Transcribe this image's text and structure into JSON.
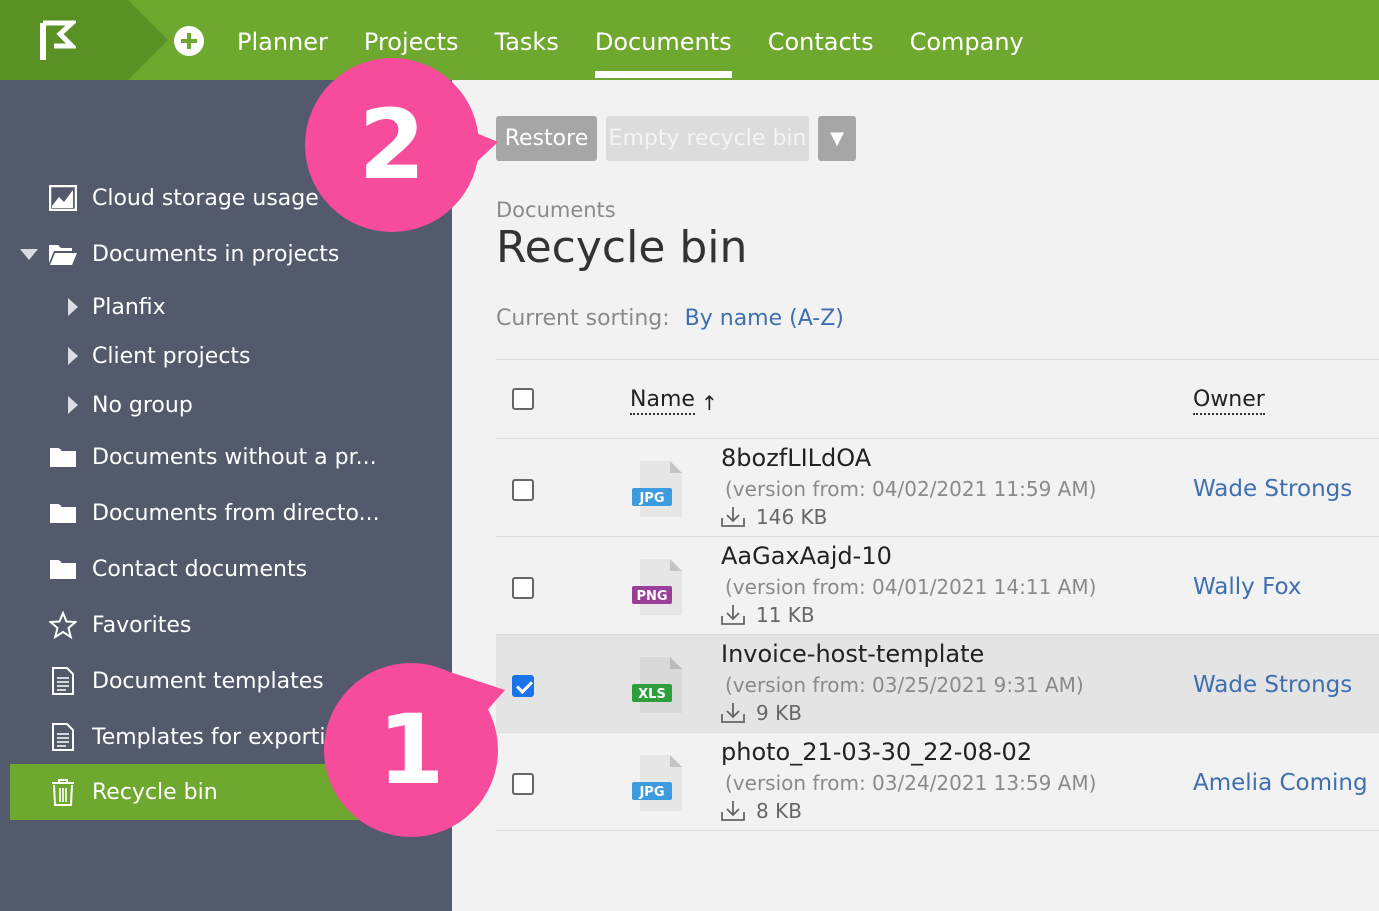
{
  "topbar": {
    "nav": [
      "Planner",
      "Projects",
      "Tasks",
      "Documents",
      "Contacts",
      "Company"
    ],
    "active": "Documents"
  },
  "sidebar": {
    "items": [
      {
        "label": "Cloud storage usage",
        "icon": "chart-icon"
      },
      {
        "label": "Documents in projects",
        "icon": "folder-open-icon"
      },
      {
        "label": "Planfix",
        "icon": "caret-right-icon"
      },
      {
        "label": "Client projects",
        "icon": "caret-right-icon"
      },
      {
        "label": "No group",
        "icon": "caret-right-icon"
      },
      {
        "label": "Documents without a pr...",
        "icon": "folder-icon"
      },
      {
        "label": "Documents from directo...",
        "icon": "folder-icon"
      },
      {
        "label": "Contact documents",
        "icon": "folder-icon"
      },
      {
        "label": "Favorites",
        "icon": "star-icon"
      },
      {
        "label": "Document templates",
        "icon": "document-icon"
      },
      {
        "label": "Templates for exporting",
        "icon": "document-icon"
      },
      {
        "label": "Recycle bin",
        "icon": "trash-icon"
      }
    ]
  },
  "toolbar": {
    "restore_label": "Restore",
    "empty_label": "Empty recycle bin",
    "more_label": "▼"
  },
  "main": {
    "breadcrumb": "Documents",
    "title": "Recycle bin",
    "sorting_label": "Current sorting:",
    "sorting_value": "By name (A-Z)"
  },
  "table": {
    "headers": {
      "name": "Name",
      "owner": "Owner",
      "sort_arrow": "↑"
    },
    "rows": [
      {
        "name": "8bozfLILdOA",
        "version": "(version from: 04/02/2021 11:59 AM)",
        "size": "146 KB",
        "owner": "Wade Strongs",
        "type": "JPG",
        "type_color": "#3d9be0",
        "checked": false
      },
      {
        "name": "AaGaxAajd-10",
        "version": "(version from: 04/01/2021 14:11 AM)",
        "size": "11 KB",
        "owner": "Wally Fox",
        "type": "PNG",
        "type_color": "#9a3f98",
        "checked": false
      },
      {
        "name": "Invoice-host-template",
        "version": "(version from: 03/25/2021 9:31 AM)",
        "size": "9 KB",
        "owner": "Wade Strongs",
        "type": "XLS",
        "type_color": "#2e9e3a",
        "checked": true
      },
      {
        "name": "photo_21-03-30_22-08-02",
        "version": "(version from: 03/24/2021 13:59 AM)",
        "size": "8 KB",
        "owner": "Amelia Coming",
        "type": "JPG",
        "type_color": "#3d9be0",
        "checked": false
      }
    ]
  },
  "callouts": [
    "2",
    "1"
  ],
  "colors": {
    "brand": "#6ea82e",
    "sidebar": "#525a6b",
    "callout": "#f74b9b",
    "link": "#3f6fb0"
  }
}
